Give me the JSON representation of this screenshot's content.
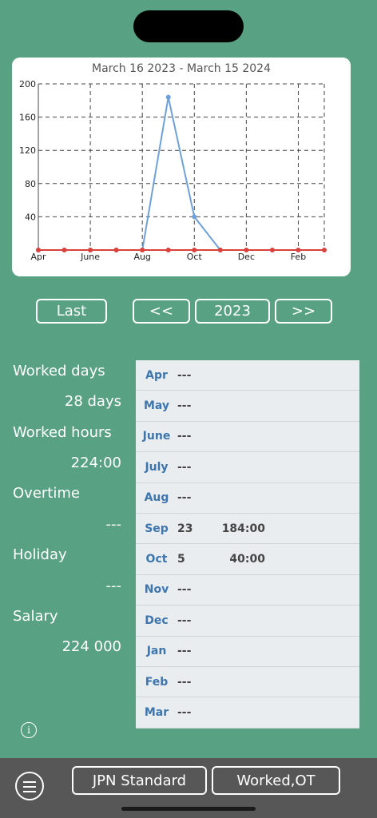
{
  "chart_data": {
    "type": "line",
    "title": "March 16 2023 - March 15 2024",
    "x_tick_labels": [
      "Apr",
      "June",
      "Aug",
      "Oct",
      "Dec",
      "Feb"
    ],
    "y_tick_labels": [
      "40",
      "80",
      "120",
      "160",
      "200"
    ],
    "ylim": [
      0,
      200
    ],
    "categories": [
      "Apr",
      "May",
      "June",
      "July",
      "Aug",
      "Sep",
      "Oct",
      "Nov",
      "Dec",
      "Jan",
      "Feb",
      "Mar"
    ],
    "series": [
      {
        "values": [
          0,
          0,
          0,
          0,
          0,
          184,
          40,
          0,
          null,
          null,
          null,
          null
        ],
        "color": "#6fa0d8"
      },
      {
        "values": [
          0,
          0,
          0,
          0,
          0,
          0,
          0,
          0,
          0,
          0,
          0,
          0
        ],
        "color": "#d9413a"
      }
    ],
    "grid": true
  },
  "nav": {
    "last": "Last",
    "prev": "<<",
    "year": "2023",
    "next": ">>"
  },
  "stats": {
    "worked_days_label": "Worked days",
    "worked_days_value": "28 days",
    "worked_hours_label": "Worked hours",
    "worked_hours_value": "224:00",
    "overtime_label": "Overtime",
    "overtime_value": "---",
    "holiday_label": "Holiday",
    "holiday_value": "---",
    "salary_label": "Salary",
    "salary_value": "224 000"
  },
  "months": [
    {
      "month": "Apr",
      "days": "---",
      "hours": ""
    },
    {
      "month": "May",
      "days": "---",
      "hours": ""
    },
    {
      "month": "June",
      "days": "---",
      "hours": ""
    },
    {
      "month": "July",
      "days": "---",
      "hours": ""
    },
    {
      "month": "Aug",
      "days": "---",
      "hours": ""
    },
    {
      "month": "Sep",
      "days": "23",
      "hours": "184:00"
    },
    {
      "month": "Oct",
      "days": "5",
      "hours": "40:00"
    },
    {
      "month": "Nov",
      "days": "---",
      "hours": ""
    },
    {
      "month": "Dec",
      "days": "---",
      "hours": ""
    },
    {
      "month": "Jan",
      "days": "---",
      "hours": ""
    },
    {
      "month": "Feb",
      "days": "---",
      "hours": ""
    },
    {
      "month": "Mar",
      "days": "---",
      "hours": ""
    }
  ],
  "info_icon": "i",
  "bottom": {
    "standard": "JPN Standard",
    "mode": "Worked,OT"
  },
  "icons": {
    "menu": "hamburger-menu-icon",
    "info": "info-icon"
  }
}
